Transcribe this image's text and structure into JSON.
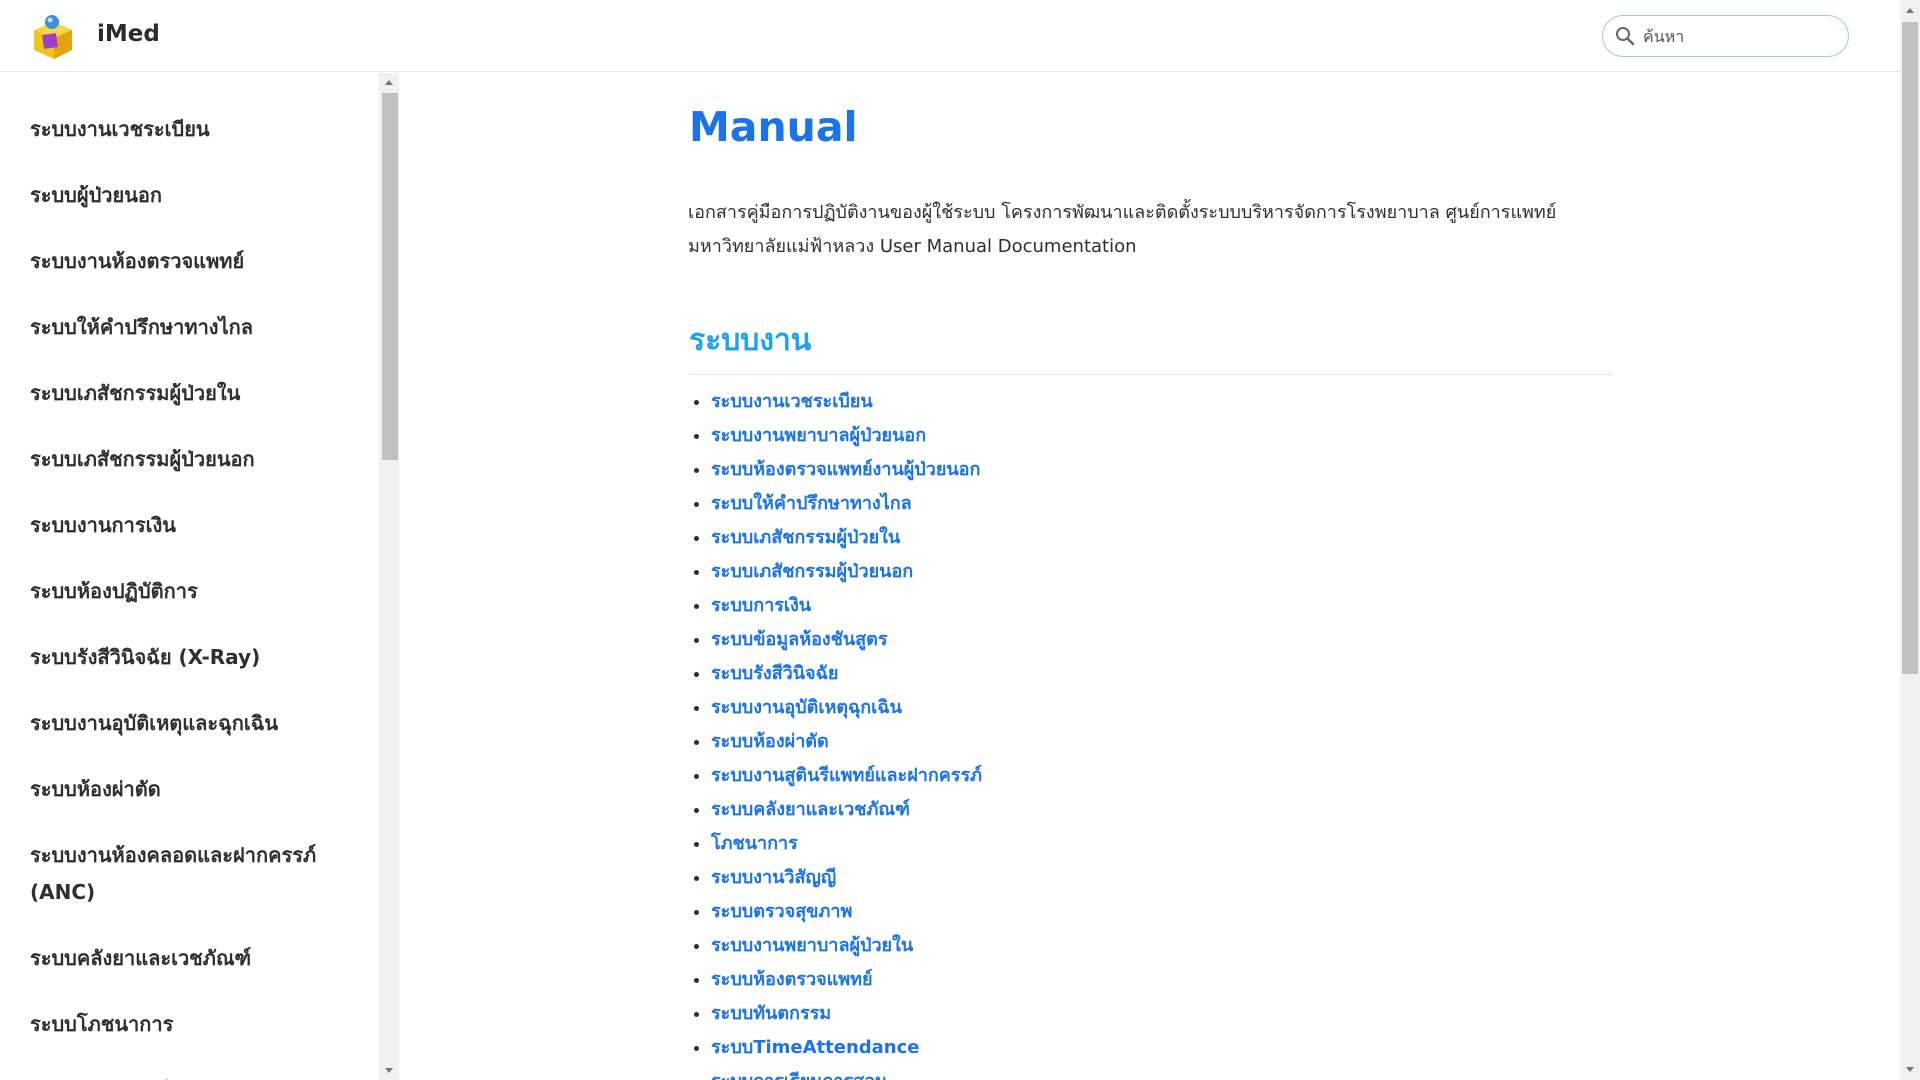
{
  "header": {
    "brand": "iMed",
    "logo_icon": "imed-logo-icon",
    "search_placeholder": "ค้นหา"
  },
  "sidebar": {
    "items": [
      {
        "label": "ระบบงานเวชระเบียน"
      },
      {
        "label": "ระบบผู้ป่วยนอก"
      },
      {
        "label": "ระบบงานห้องตรวจแพทย์"
      },
      {
        "label": "ระบบให้คำปรึกษาทางไกล"
      },
      {
        "label": "ระบบเภสัชกรรมผู้ป่วยใน"
      },
      {
        "label": "ระบบเภสัชกรรมผู้ป่วยนอก"
      },
      {
        "label": "ระบบงานการเงิน"
      },
      {
        "label": "ระบบห้องปฏิบัติการ"
      },
      {
        "label": "ระบบรังสีวินิจฉัย (X-Ray)"
      },
      {
        "label": "ระบบงานอุบัติเหตุและฉุกเฉิน"
      },
      {
        "label": "ระบบห้องผ่าตัด"
      },
      {
        "label": "ระบบงานห้องคลอดและฝากครรภ์ (ANC)"
      },
      {
        "label": "ระบบคลังยาและเวชภัณฑ์"
      },
      {
        "label": "ระบบโภชนาการ"
      },
      {
        "label": "ระบบงานวิสัญญี"
      }
    ]
  },
  "main": {
    "title": "Manual",
    "intro": "เอกสารคู่มือการปฏิบัติงานของผู้ใช้ระบบ โครงการพัฒนาและติดตั้งระบบบริหารจัดการโรงพยาบาล ศูนย์การแพทย์ มหาวิทยาลัยแม่ฟ้าหลวง User Manual Documentation",
    "section_title": "ระบบงาน",
    "links": [
      {
        "label": "ระบบงานเวชระเบียน"
      },
      {
        "label": "ระบบงานพยาบาลผู้ป่วยนอก"
      },
      {
        "label": "ระบบห้องตรวจแพทย์งานผู้ป่วยนอก"
      },
      {
        "label": "ระบบให้คำปรึกษาทางไกล"
      },
      {
        "label": "ระบบเภสัชกรรมผู้ป่วยใน"
      },
      {
        "label": "ระบบเภสัชกรรมผู้ป่วยนอก"
      },
      {
        "label": "ระบบการเงิน"
      },
      {
        "label": "ระบบข้อมูลห้องชันสูตร"
      },
      {
        "label": "ระบบรังสีวินิจฉัย"
      },
      {
        "label": "ระบบงานอุบัติเหตุฉุกเฉิน"
      },
      {
        "label": "ระบบห้องผ่าตัด"
      },
      {
        "label": "ระบบงานสูตินรีแพทย์และฝากครรภ์"
      },
      {
        "label": "ระบบคลังยาและเวชภัณฑ์"
      },
      {
        "label": "โภชนาการ"
      },
      {
        "label": "ระบบงานวิสัญญี"
      },
      {
        "label": "ระบบตรวจสุขภาพ"
      },
      {
        "label": "ระบบงานพยาบาลผู้ป่วยใน"
      },
      {
        "label": "ระบบห้องตรวจแพทย์"
      },
      {
        "label": "ระบบทันตกรรม"
      },
      {
        "label": "ระบบTimeAttendance"
      },
      {
        "label": "ระบบการเรียนการสอน"
      }
    ]
  },
  "colors": {
    "title_blue": "#1a73e8",
    "section_blue": "#1da1f2",
    "search_border": "#9ecbe8"
  }
}
